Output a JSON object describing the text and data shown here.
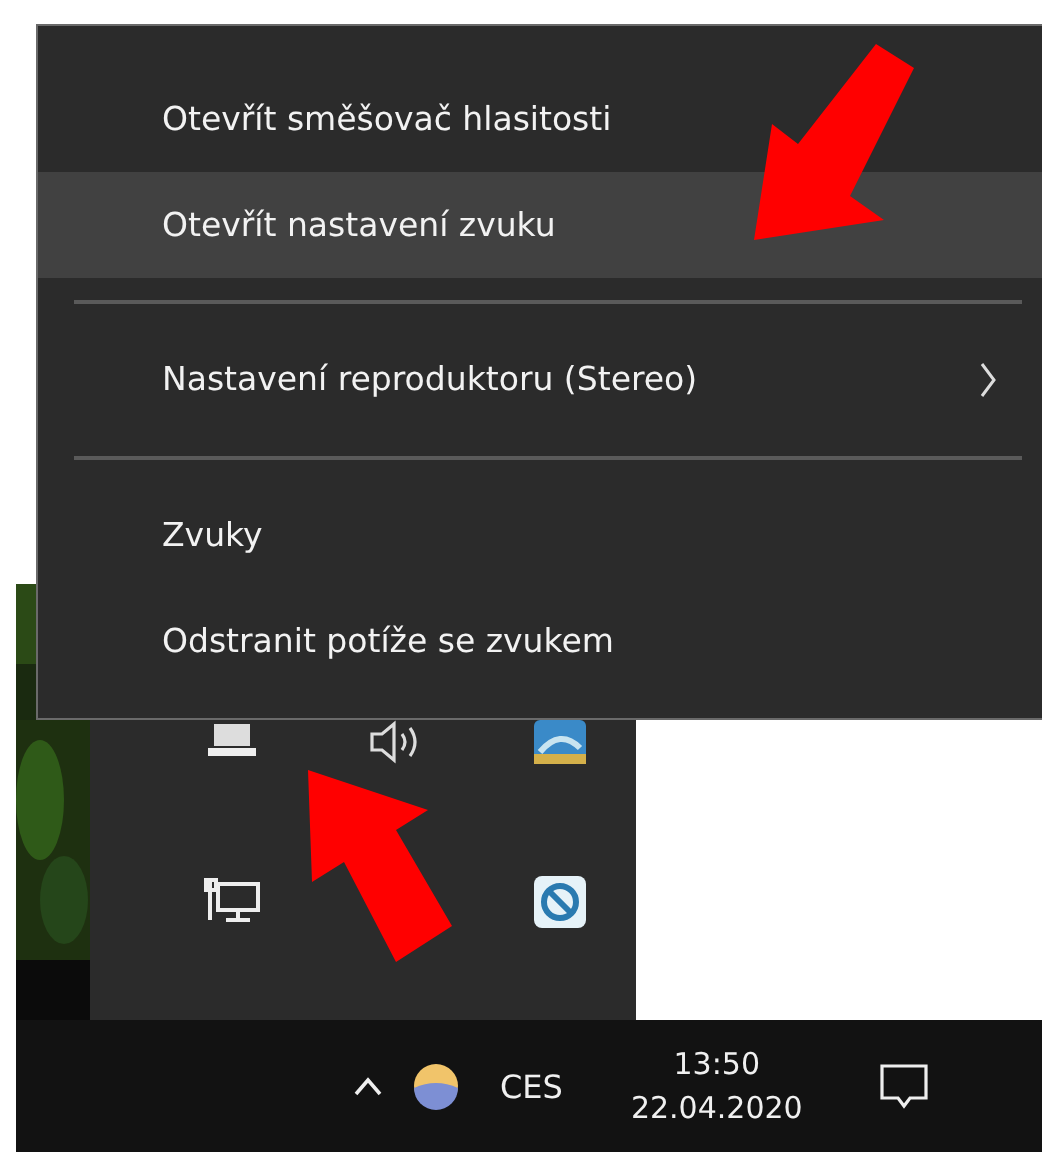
{
  "context_menu": {
    "entries": [
      {
        "kind": "item",
        "label": "Otevřít směšovač hlasitosti",
        "selected": false,
        "submenu": false
      },
      {
        "kind": "item",
        "label": "Otevřít nastavení zvuku",
        "selected": true,
        "submenu": false
      },
      {
        "kind": "separator"
      },
      {
        "kind": "item",
        "label": "Nastavení reproduktoru (Stereo)",
        "selected": false,
        "submenu": true
      },
      {
        "kind": "separator"
      },
      {
        "kind": "item",
        "label": "Zvuky",
        "selected": false,
        "submenu": false
      },
      {
        "kind": "item",
        "label": "Odstranit potíže se zvukem",
        "selected": false,
        "submenu": false
      }
    ]
  },
  "taskbar": {
    "language": "CES",
    "time": "13:50",
    "date": "22.04.2020"
  }
}
